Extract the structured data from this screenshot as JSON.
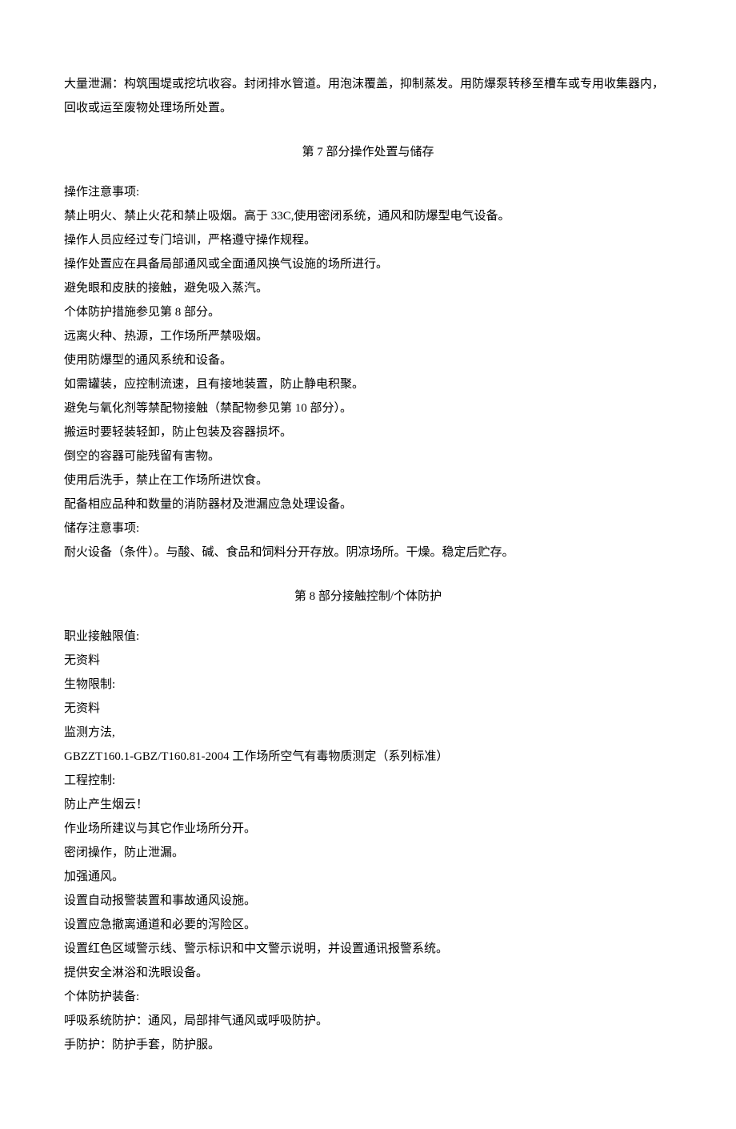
{
  "intro": "大量泄漏：构筑围堤或挖坑收容。封闭排水管道。用泡沫覆盖，抑制蒸发。用防爆泵转移至槽车或专用收集器内，回收或运至废物处理场所处置。",
  "section7": {
    "title": "第 7 部分操作处置与储存",
    "lines": [
      "操作注意事项:",
      "禁止明火、禁止火花和禁止吸烟。高于 33C,使用密闭系统，通风和防爆型电气设备。",
      "操作人员应经过专门培训，严格遵守操作规程。",
      "操作处置应在具备局部通风或全面通风换气设施的场所进行。",
      "避免眼和皮肤的接触，避免吸入蒸汽。",
      "个体防护措施参见第 8 部分。",
      "远离火种、热源，工作场所严禁吸烟。",
      "使用防爆型的通风系统和设备。",
      "如需罐装，应控制流速，且有接地装置，防止静电积聚。",
      "避免与氧化剂等禁配物接触（禁配物参见第 10 部分）。",
      "搬运时要轻装轻卸，防止包装及容器损坏。",
      "倒空的容器可能残留有害物。",
      "使用后洗手，禁止在工作场所进饮食。",
      "配备相应品种和数量的消防器材及泄漏应急处理设备。",
      "储存注意事项:",
      "耐火设备（条件）。与酸、碱、食品和饲料分开存放。阴凉场所。干燥。稳定后贮存。"
    ]
  },
  "section8": {
    "title": "第 8 部分接触控制/个体防护",
    "lines": [
      "职业接触限值:",
      "无资料",
      "生物限制:",
      "无资料",
      "监测方法,",
      "GBZZT160.1-GBZ/T160.81-2004 工作场所空气有毒物质测定（系列标准）",
      "工程控制:",
      "防止产生烟云！",
      "作业场所建议与其它作业场所分开。",
      "密闭操作，防止泄漏。",
      "加强通风。",
      "设置自动报警装置和事故通风设施。",
      "设置应急撤离通道和必要的泻险区。",
      "设置红色区域警示线、警示标识和中文警示说明，并设置通讯报警系统。",
      "提供安全淋浴和洗眼设备。",
      "个体防护装备:",
      "呼吸系统防护：通风，局部排气通风或呼吸防护。",
      "手防护：防护手套，防护服。"
    ]
  }
}
